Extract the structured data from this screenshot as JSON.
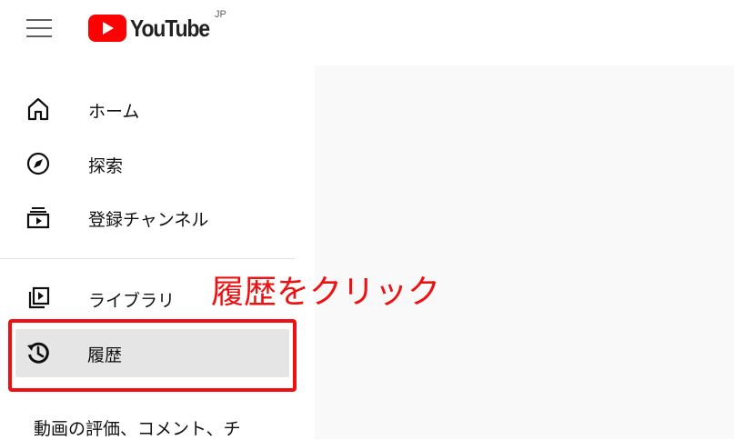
{
  "header": {
    "logo_text": "YouTube",
    "region": "JP"
  },
  "sidebar": {
    "items": [
      {
        "label": "ホーム",
        "icon": "home-icon"
      },
      {
        "label": "探索",
        "icon": "compass-icon"
      },
      {
        "label": "登録チャンネル",
        "icon": "subscriptions-icon"
      },
      {
        "label": "ライブラリ",
        "icon": "library-icon"
      },
      {
        "label": "履歴",
        "icon": "history-icon",
        "active": true
      }
    ],
    "section_text": "動画の評価、コメント、チ"
  },
  "annotation": {
    "text": "履歴をクリック",
    "color": "#ee1111"
  },
  "colors": {
    "brand_red": "#ff0000",
    "active_bg": "#e5e5e5",
    "main_bg": "#f9f9f9"
  }
}
